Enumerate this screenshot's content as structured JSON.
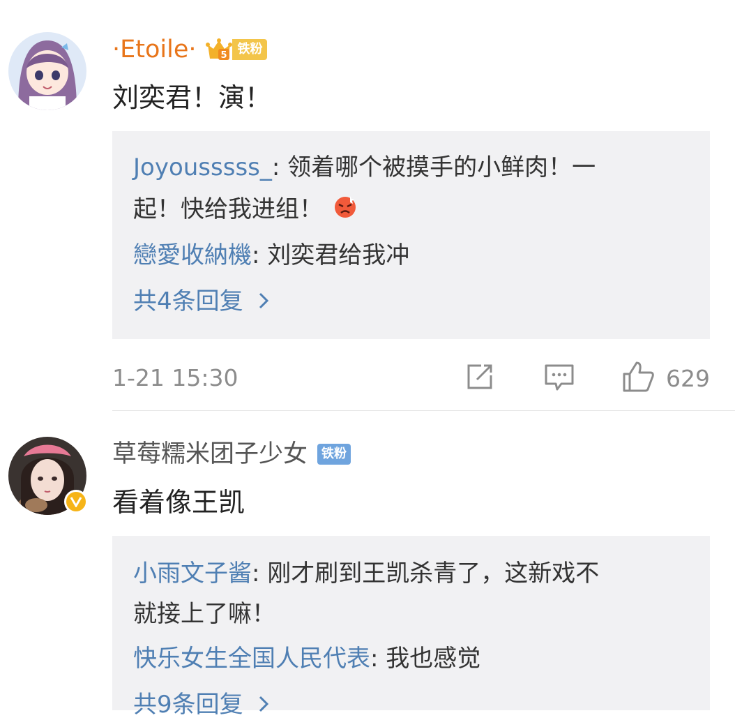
{
  "comments": [
    {
      "user": "·Etoile·",
      "badge": "铁粉",
      "badge_level": "5",
      "text": "刘奕君！演！",
      "replies": [
        {
          "name": "Joyousssss_",
          "sep": ": ",
          "text": "领着哪个被摸手的小鲜肉！一",
          "text2": "起！快给我进组！"
        },
        {
          "name": "戀愛收納機",
          "sep": ": ",
          "text": "刘奕君给我冲"
        }
      ],
      "more": "共4条回复",
      "time": "1-21 15:30",
      "likes": "629"
    },
    {
      "user": "草莓糯米团子少女",
      "badge": "铁粉",
      "text": "看着像王凯",
      "replies": [
        {
          "name": "小雨文子酱",
          "sep": ": ",
          "text": "刚才刷到王凯杀青了，这新戏不",
          "text2": "就接上了嘛！"
        },
        {
          "name": "快乐女生全国人民代表",
          "sep": ": ",
          "text": "我也感觉"
        }
      ],
      "more": "共9条回复"
    }
  ],
  "colors": {
    "username_orange": "#e8751a",
    "reply_name": "#4f7fb3",
    "fan_gold": "#f3c54a",
    "fan_blue": "#6fa4de"
  },
  "icons": [
    "repost-icon",
    "comment-icon",
    "like-icon",
    "chevron-right-icon",
    "angry-emoji-icon",
    "verified-v-icon",
    "crown-icon"
  ]
}
